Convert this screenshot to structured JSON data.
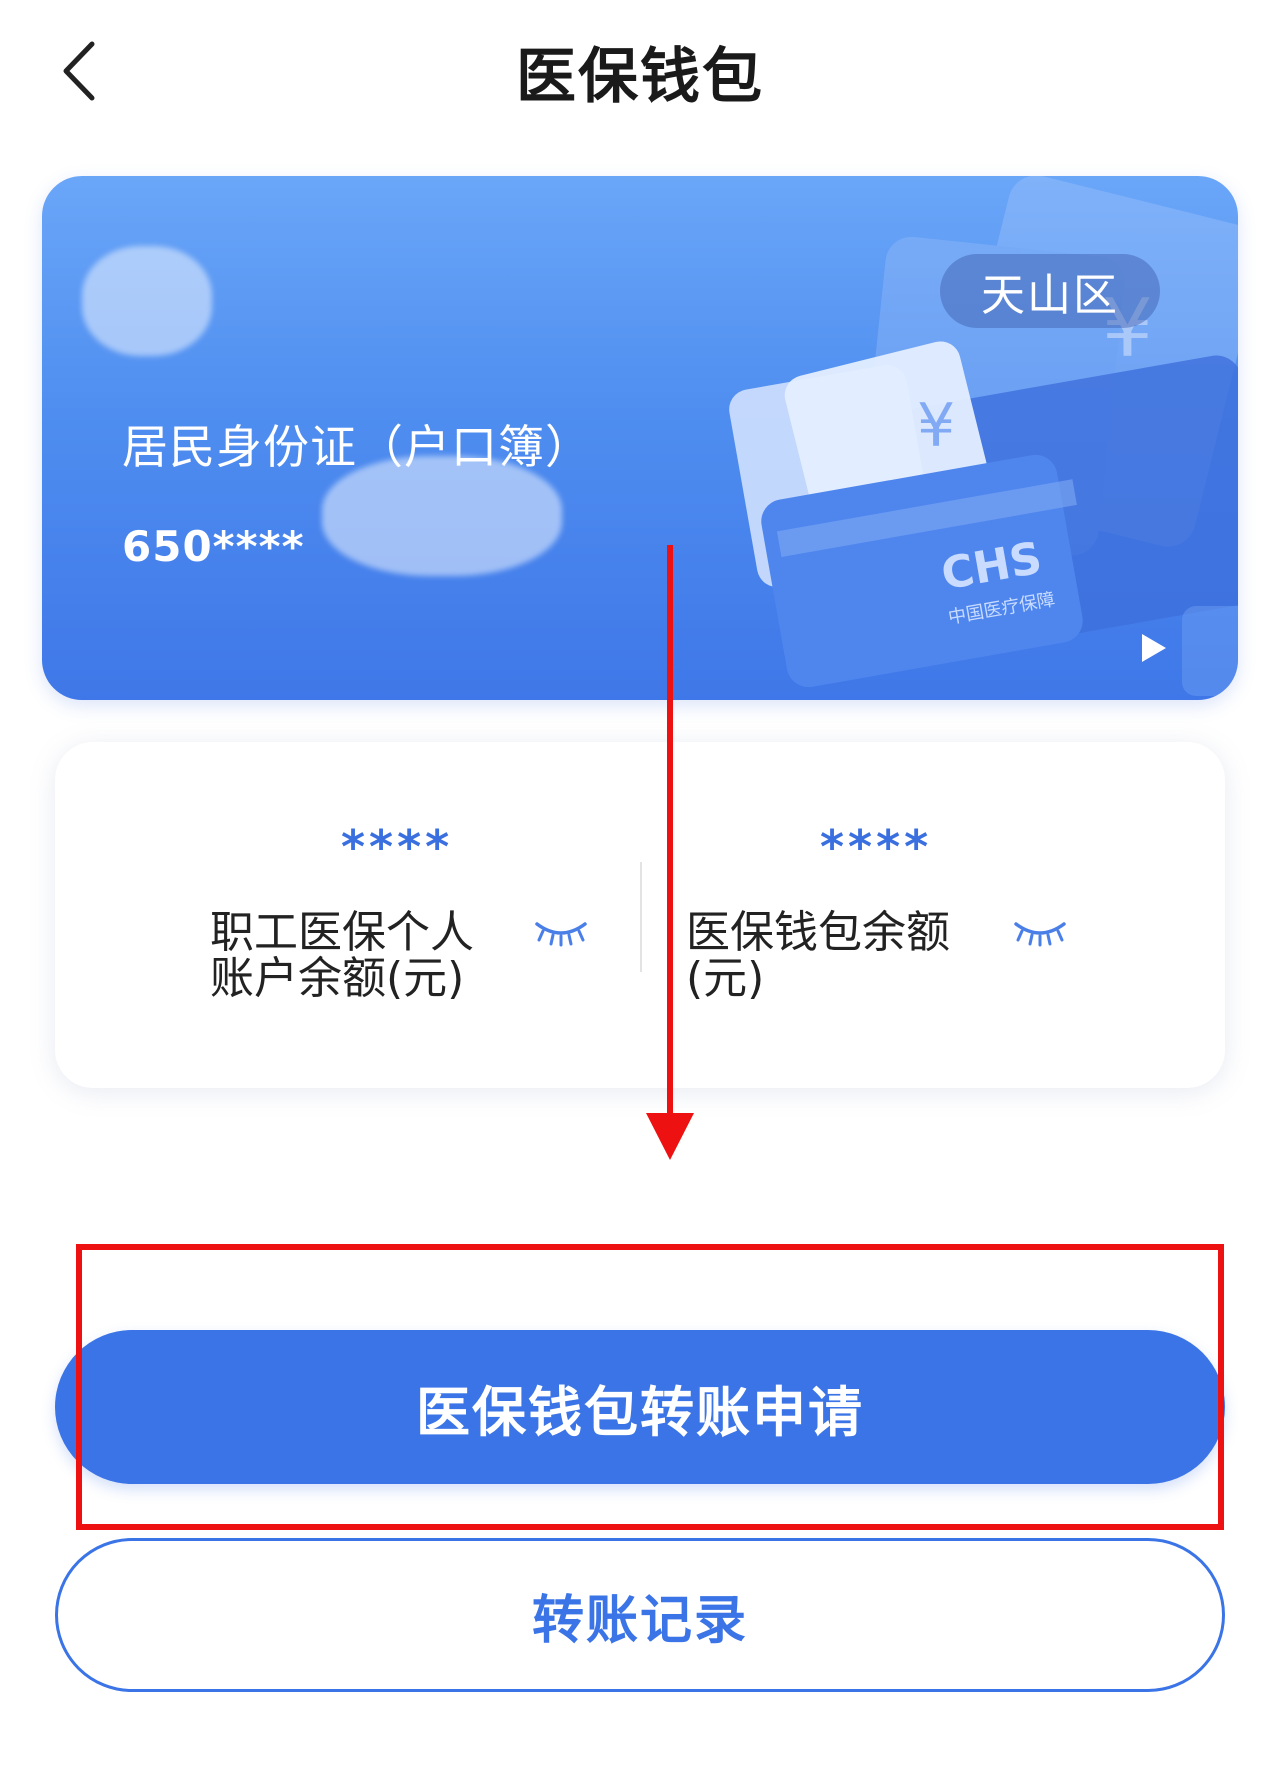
{
  "header": {
    "title": "医保钱包",
    "back_icon": "chevron-left-icon"
  },
  "card": {
    "region": "天山区",
    "id_type": "居民身份证（户口簿）",
    "id_number": "650****",
    "play_icon": "play-icon",
    "logo_text": "CHS",
    "logo_subtext": "中国医疗保障"
  },
  "balances": {
    "employee_account": {
      "value": "****",
      "label_line1": "职工医保个人",
      "label_line2": "账户余额(元)",
      "eye_icon": "eye-closed-icon"
    },
    "wallet": {
      "value": "****",
      "label_line1": "医保钱包余额",
      "label_line2": "(元)",
      "eye_icon": "eye-closed-icon"
    }
  },
  "actions": {
    "transfer_apply": "医保钱包转账申请",
    "transfer_records": "转账记录"
  },
  "colors": {
    "accent": "#3a74e6",
    "annotation": "#ee1111"
  }
}
